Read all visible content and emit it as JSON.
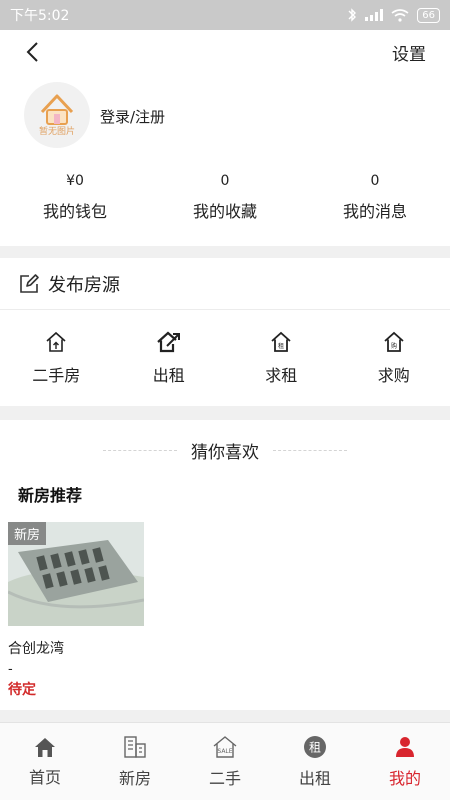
{
  "status_bar": {
    "time": "下午5:02",
    "battery": "66"
  },
  "header": {
    "settings_label": "设置"
  },
  "profile": {
    "avatar_caption": "暂无图片",
    "login_label": "登录/注册"
  },
  "stats": [
    {
      "value": "¥0",
      "label": "我的钱包"
    },
    {
      "value": "0",
      "label": "我的收藏"
    },
    {
      "value": "0",
      "label": "我的消息"
    }
  ],
  "publish": {
    "title": "发布房源"
  },
  "quick_actions": [
    {
      "label": "二手房",
      "icon": "house-outline-icon"
    },
    {
      "label": "出租",
      "icon": "house-arrow-icon"
    },
    {
      "label": "求租",
      "icon": "house-rent-icon"
    },
    {
      "label": "求购",
      "icon": "house-buy-icon"
    }
  ],
  "recommend": {
    "guess_title": "猜你喜欢",
    "section_title": "新房推荐",
    "card": {
      "tag": "新房",
      "name": "合创龙湾",
      "sub": "-",
      "price": "待定"
    }
  },
  "bottom_nav": [
    {
      "label": "首页",
      "icon": "home-icon"
    },
    {
      "label": "新房",
      "icon": "building-icon"
    },
    {
      "label": "二手",
      "icon": "sale-house-icon"
    },
    {
      "label": "出租",
      "icon": "rent-icon"
    },
    {
      "label": "我的",
      "icon": "user-icon",
      "active": true
    }
  ],
  "colors": {
    "accent": "#d8252e",
    "price": "#d22a2a"
  }
}
